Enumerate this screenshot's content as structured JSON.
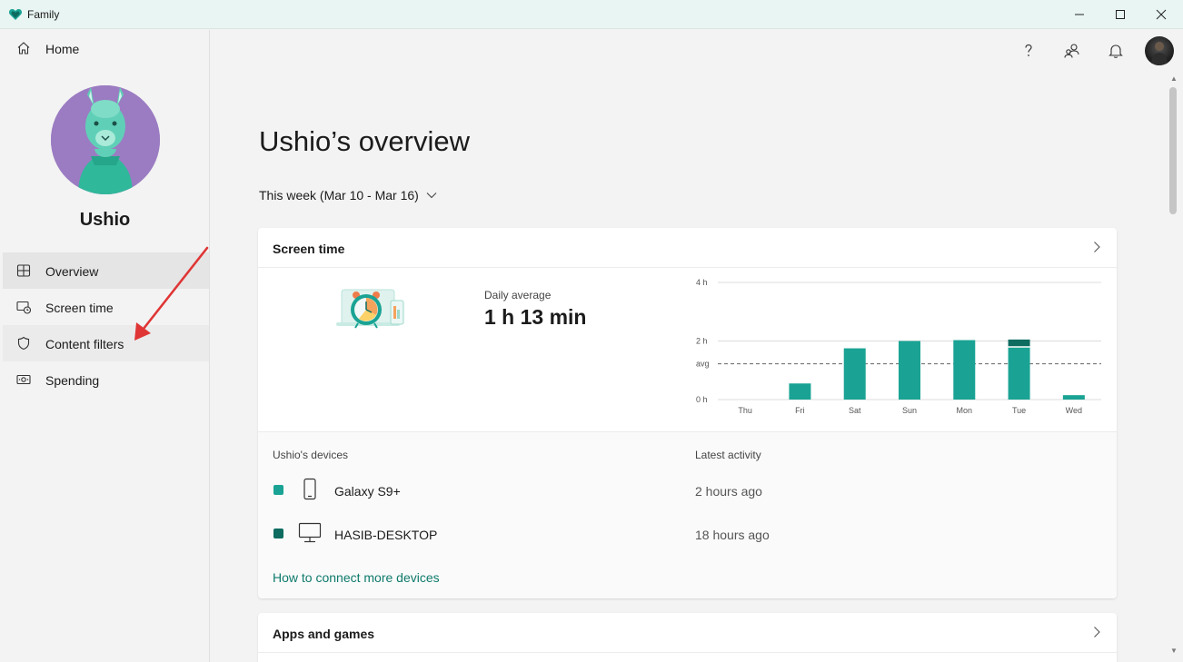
{
  "window": {
    "title": "Family"
  },
  "sidebar": {
    "home_label": "Home",
    "profile_name": "Ushio",
    "items": [
      {
        "label": "Overview",
        "icon": "overview-icon"
      },
      {
        "label": "Screen time",
        "icon": "screen-time-icon"
      },
      {
        "label": "Content filters",
        "icon": "shield-icon"
      },
      {
        "label": "Spending",
        "icon": "money-icon"
      }
    ]
  },
  "header": {
    "icons": [
      "help-icon",
      "family-settings-icon",
      "bell-icon",
      "user-avatar"
    ]
  },
  "main": {
    "title": "Ushio’s overview",
    "week_label": "This week (Mar 10 - Mar 16)",
    "screen_time": {
      "title": "Screen time",
      "daily_avg_label": "Daily average",
      "daily_avg_value": "1 h 13 min"
    },
    "devices": {
      "col_devices": "Ushio's devices",
      "col_activity": "Latest activity",
      "items": [
        {
          "name": "Galaxy S9+",
          "activity": "2 hours ago",
          "color": "#1aa394",
          "icon": "phone-icon"
        },
        {
          "name": "HASIB-DESKTOP",
          "activity": "18 hours ago",
          "color": "#0d6b60",
          "icon": "desktop-icon"
        }
      ],
      "connect_link": "How to connect more devices"
    },
    "apps": {
      "title": "Apps and games"
    }
  },
  "chart_data": {
    "type": "bar",
    "categories": [
      "Thu",
      "Fri",
      "Sat",
      "Sun",
      "Mon",
      "Tue",
      "Wed"
    ],
    "series": [
      {
        "values": [
          0,
          0.55,
          1.75,
          2.0,
          2.03,
          1.8,
          0.15
        ]
      },
      {
        "values": [
          0,
          0,
          0,
          0,
          0,
          0.25,
          0
        ]
      }
    ],
    "y_tick_labels": [
      "4 h",
      "2 h",
      "avg",
      "0 h"
    ],
    "avg_hours": 1.22,
    "ylim": [
      0,
      4
    ],
    "colors": [
      "#1aa394",
      "#0d6b60"
    ]
  }
}
